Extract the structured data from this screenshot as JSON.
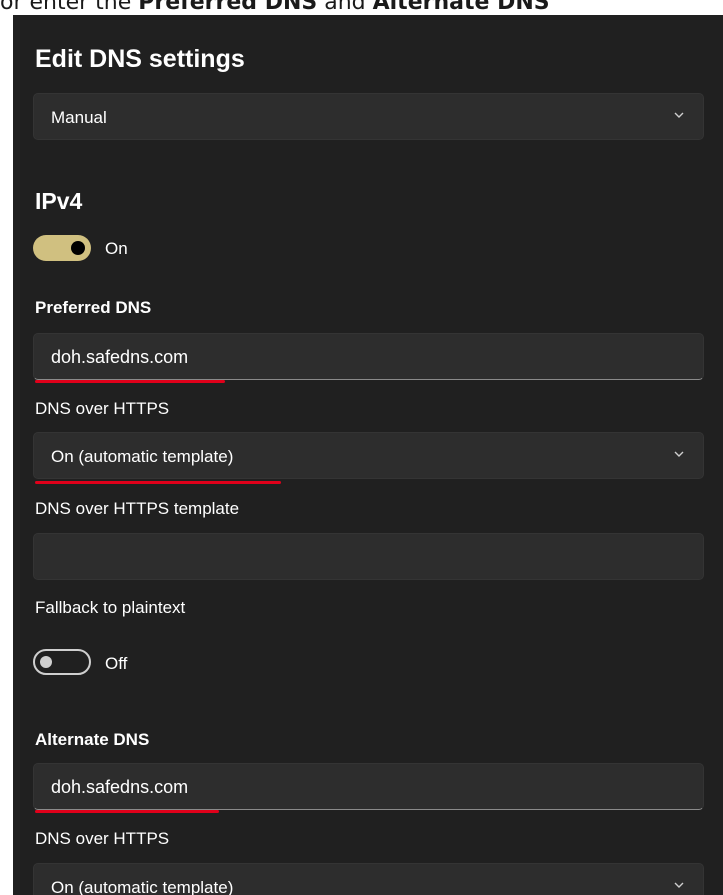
{
  "caption": {
    "prefix": "or enter the ",
    "term1": "Preferred DNS",
    "middle": " and ",
    "term2": "Alternate DNS"
  },
  "dialog": {
    "title": "Edit DNS settings",
    "mode_dropdown": {
      "value": "Manual",
      "icon": "chevron-down-icon"
    }
  },
  "ipv4": {
    "title": "IPv4",
    "toggle": {
      "state": "on",
      "label": "On",
      "color": "#d0c080"
    },
    "preferred": {
      "label": "Preferred DNS",
      "value": "doh.safedns.com",
      "doh_label": "DNS over HTTPS",
      "doh_value": "On (automatic template)",
      "template_label": "DNS over HTTPS template",
      "template_value": "",
      "fallback_label": "Fallback to plaintext",
      "fallback_toggle": {
        "state": "off",
        "label": "Off"
      }
    },
    "alternate": {
      "label": "Alternate DNS",
      "value": "doh.safedns.com",
      "doh_label": "DNS over HTTPS",
      "doh_value": "On (automatic template)"
    }
  },
  "annotation_color": "#e0001a"
}
